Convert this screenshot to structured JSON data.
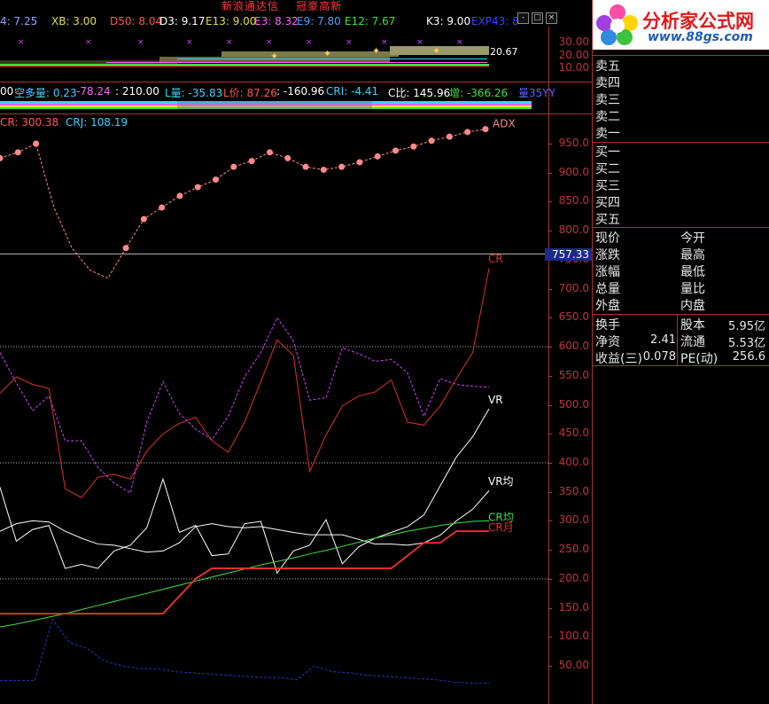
{
  "header": {
    "broker": "新浪通达信",
    "stock": "冠豪高新"
  },
  "top_indicators": [
    {
      "text": "4: 7.25",
      "color": "#9aa0ff"
    },
    {
      "text": "XB: 3.00",
      "color": "#e0e040"
    },
    {
      "text": "D50: 8.04",
      "color": "#ff5555"
    },
    {
      "text": "D3: 9.17",
      "color": "#ffffff"
    },
    {
      "text": "E13: 9.00",
      "color": "#e0e040"
    },
    {
      "text": "E3: 8.32",
      "color": "#ff60ff"
    },
    {
      "text": "E9: 7.80",
      "color": "#4aa0ff"
    },
    {
      "text": "E12: 7.67",
      "color": "#40e040"
    },
    {
      "text": "K3: 9.00",
      "color": "#ffffff"
    },
    {
      "text": "EXP43: 8",
      "color": "#4040ff"
    }
  ],
  "small_axis": {
    "labels": [
      "30.00",
      "20.00",
      "10.00"
    ],
    "extra_label": "20.67"
  },
  "mid_indicators": [
    {
      "text": "00",
      "color": "#ffffff"
    },
    {
      "text": "空多量: 0.23",
      "color": "#40d0ff"
    },
    {
      "text": "-78.24",
      "color": "#ff60ff"
    },
    {
      "text": ": 210.00",
      "color": "#ffffff"
    },
    {
      "text": "L量: -35.83",
      "color": "#40d0ff"
    },
    {
      "text": "L价: 87.26",
      "color": "#ff5555"
    },
    {
      "text": ": -160.96",
      "color": "#ffffff"
    },
    {
      "text": "CRI: -4.41",
      "color": "#40d0ff"
    },
    {
      "text": "C比: 145.96",
      "color": "#ffffff"
    },
    {
      "text": "增: -366.26",
      "color": "#40e040"
    },
    {
      "text": "量35YY",
      "color": "#6060ff"
    }
  ],
  "cr_indicators": [
    {
      "text": "CR: 300.38",
      "color": "#ff5555"
    },
    {
      "text": "CRJ: 108.19",
      "color": "#40d0ff"
    }
  ],
  "main_axis": {
    "labels": [
      "950.0",
      "900.0",
      "850.0",
      "800.0",
      "750.0",
      "700.0",
      "650.0",
      "600.0",
      "550.0",
      "500.0",
      "450.0",
      "400.0",
      "350.0",
      "300.0",
      "250.0",
      "200.0",
      "150.0",
      "100.0",
      "50.00"
    ],
    "highlight": "757.33"
  },
  "line_labels": {
    "cr": "CR",
    "vr": "VR",
    "vr_avg": "VR均",
    "cr_avg": "CR均",
    "cr_month": "CR月",
    "top": "ADX"
  },
  "chart_data": {
    "type": "line",
    "ylim": [
      0,
      1000
    ],
    "series": [
      {
        "name": "CR",
        "color": "#e0302c",
        "values": [
          520,
          548,
          535,
          528,
          355,
          340,
          375,
          380,
          372,
          420,
          450,
          468,
          478,
          438,
          418,
          470,
          540,
          612,
          585,
          385,
          448,
          498,
          515,
          522,
          543,
          470,
          465,
          498,
          545,
          590,
          735
        ]
      },
      {
        "name": "VR",
        "color": "#ffffff",
        "values": [
          358,
          265,
          285,
          292,
          218,
          225,
          218,
          248,
          258,
          288,
          372,
          280,
          292,
          240,
          243,
          295,
          299,
          210,
          248,
          258,
          302,
          226,
          255,
          270,
          280,
          290,
          310,
          360,
          410,
          445,
          493
        ]
      },
      {
        "name": "VR均",
        "color": "#ffffff",
        "values": [
          282,
          295,
          300,
          298,
          282,
          270,
          260,
          258,
          252,
          246,
          248,
          262,
          290,
          295,
          290,
          288,
          290,
          285,
          280,
          276,
          276,
          276,
          268,
          260,
          260,
          258,
          262,
          275,
          300,
          320,
          352
        ]
      },
      {
        "name": "CR均",
        "color": "#40e040",
        "values": [
          117,
          122,
          128,
          134,
          140,
          147,
          154,
          161,
          168,
          175,
          182,
          189,
          196,
          203,
          210,
          217,
          224,
          230,
          236,
          243,
          249,
          256,
          263,
          270,
          276,
          282,
          287,
          292,
          296,
          299,
          300
        ]
      },
      {
        "name": "CR月",
        "color": "#e0302c",
        "values": [
          140,
          140,
          140,
          140,
          140,
          140,
          140,
          140,
          140,
          140,
          140,
          170,
          200,
          218,
          218,
          218,
          218,
          218,
          218,
          218,
          218,
          218,
          218,
          218,
          218,
          240,
          262,
          262,
          282,
          282,
          282
        ]
      },
      {
        "name": "紫虚线",
        "color": "#d040ff",
        "values": [
          590,
          538,
          490,
          515,
          438,
          438,
          392,
          365,
          348,
          470,
          540,
          485,
          458,
          440,
          480,
          548,
          590,
          650,
          610,
          508,
          512,
          598,
          588,
          575,
          578,
          555,
          480,
          545,
          535,
          532,
          530
        ]
      },
      {
        "name": "顶部点线",
        "color": "#ff8a8a",
        "values": [
          925,
          935,
          950,
          840,
          770,
          732,
          718,
          770,
          820,
          840,
          860,
          875,
          888,
          910,
          920,
          935,
          925,
          910,
          905,
          910,
          918,
          928,
          938,
          945,
          955,
          962,
          970,
          975
        ]
      },
      {
        "name": "蓝线",
        "color": "#3030c0",
        "values": [
          25,
          25,
          25,
          130,
          90,
          80,
          58,
          50,
          45,
          45,
          40,
          38,
          36,
          34,
          32,
          30,
          30,
          26,
          50,
          40,
          38,
          34,
          32,
          30,
          28,
          26,
          22,
          20,
          20
        ]
      }
    ]
  },
  "panel": {
    "sell_labels": [
      "卖五",
      "卖四",
      "卖三",
      "卖二",
      "卖一"
    ],
    "buy_labels": [
      "买一",
      "买二",
      "买三",
      "买四",
      "买五"
    ],
    "info_left": [
      "现价",
      "涨跌",
      "涨幅",
      "总量",
      "外盘"
    ],
    "info_right": [
      "今开",
      "最高",
      "最低",
      "量比",
      "内盘"
    ],
    "fund": [
      {
        "l1": "换手",
        "v1": "",
        "l2": "股本",
        "v2": "5.95亿"
      },
      {
        "l1": "净资",
        "v1": "2.41",
        "l2": "流通",
        "v2": "5.53亿"
      },
      {
        "l1": "收益(三)",
        "v1": "0.078",
        "l2": "PE(动)",
        "v2": "256.6"
      }
    ]
  },
  "logo": {
    "title": "分析家公式网",
    "url": "www.88gs.com"
  },
  "window_buttons": [
    "-",
    "□",
    "×"
  ]
}
